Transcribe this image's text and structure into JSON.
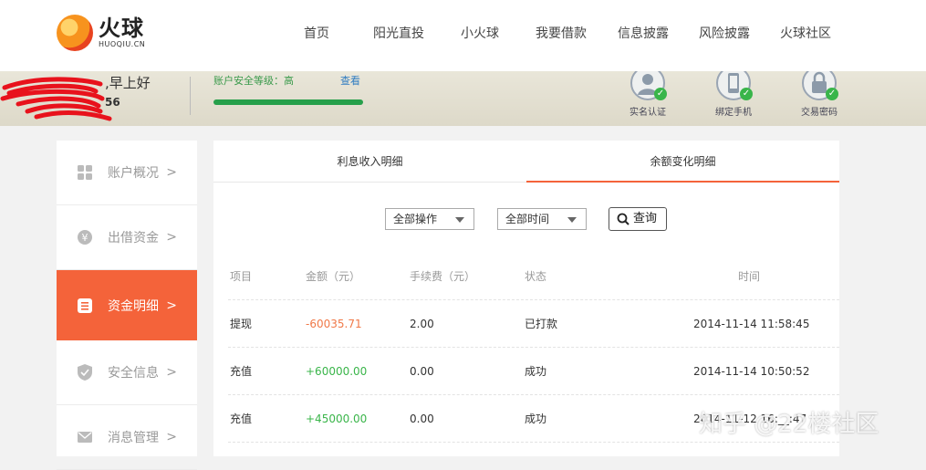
{
  "brand": {
    "name_cn": "火球",
    "name_en": "HUOQIU.CN"
  },
  "nav": [
    "首页",
    "阳光直投",
    "小火球",
    "我要借款",
    "信息披露",
    "风险披露",
    "火球社区"
  ],
  "banner": {
    "greeting": ",早上好",
    "user_suffix": "56",
    "security_label": "账户安全等级：高",
    "security_link": "查看",
    "security_progress": 1.0,
    "badges": [
      {
        "label": "实名认证",
        "icon": "user-icon"
      },
      {
        "label": "绑定手机",
        "icon": "phone-icon"
      },
      {
        "label": "交易密码",
        "icon": "lock-icon"
      }
    ]
  },
  "sidebar": {
    "items": [
      {
        "label": "账户概况",
        "icon": "grid-icon",
        "active": false
      },
      {
        "label": "出借资金",
        "icon": "yen-icon",
        "active": false
      },
      {
        "label": "资金明细",
        "icon": "document-icon",
        "active": true
      },
      {
        "label": "安全信息",
        "icon": "shield-icon",
        "active": false
      },
      {
        "label": "消息管理",
        "icon": "mail-icon",
        "active": false
      }
    ],
    "chevron": ">"
  },
  "tabs": [
    "利息收入明细",
    "余额变化明细"
  ],
  "active_tab": 1,
  "filters": {
    "operation": "全部操作",
    "time": "全部时间",
    "query_label": "查询"
  },
  "table": {
    "headers": [
      "项目",
      "金额（元）",
      "手续费（元）",
      "状态",
      "时间"
    ],
    "rows": [
      [
        "提现",
        "-60035.71",
        "2.00",
        "已打款",
        "2014-11-14 11:58:45"
      ],
      [
        "充值",
        "+60000.00",
        "0.00",
        "成功",
        "2014-11-14 10:50:52"
      ],
      [
        "充值",
        "+45000.00",
        "0.00",
        "成功",
        "2014-11-12 16:__:47"
      ]
    ]
  },
  "colors": {
    "accent": "#f4633a",
    "positive": "#3ab54a",
    "negative": "#f07948",
    "link": "#2f7cc1"
  },
  "watermark": "知乎 @22楼社区"
}
